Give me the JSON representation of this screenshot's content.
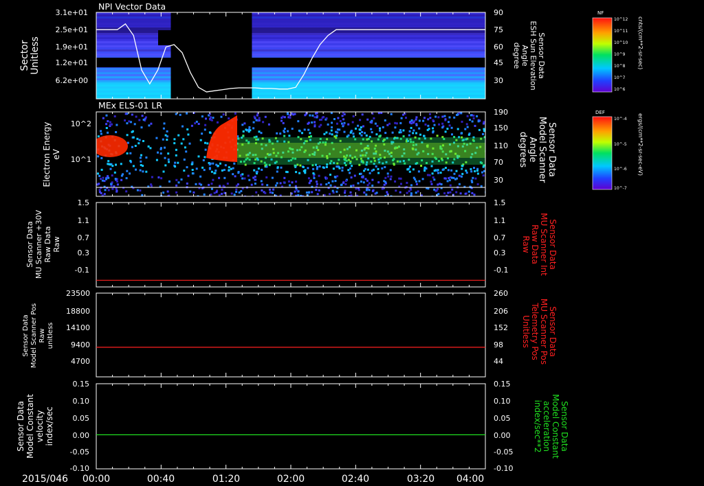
{
  "date_label": "2015/046",
  "time_ticks": [
    "00:00",
    "00:40",
    "01:20",
    "02:00",
    "02:40",
    "03:20",
    "04:00"
  ],
  "colors": {
    "red": "#ff2020",
    "green": "#20e020",
    "white": "#ffffff",
    "black": "#000000"
  },
  "chart_data": [
    {
      "type": "heatmap",
      "title": "NPI Vector Data",
      "ylabel_left": [
        "Sector",
        "Unitless"
      ],
      "left_ticks": [
        "3.1e+01",
        "2.5e+01",
        "1.9e+01",
        "1.2e+01",
        "6.2e+00"
      ],
      "ylabel_right": [
        "Sensor Data",
        "ESH Sun Elevation",
        "Angle",
        "degree"
      ],
      "right_ticks": [
        "90",
        "75",
        "60",
        "45",
        "30"
      ],
      "overlay_line": {
        "name": "ESH Sun Elevation Angle",
        "x_min": [
          0,
          8,
          13,
          18,
          23,
          28,
          33,
          38,
          43,
          48,
          53,
          58,
          63,
          68,
          73,
          78,
          83,
          88,
          93,
          98,
          103,
          108,
          113,
          118,
          123,
          128,
          133,
          138,
          143,
          148,
          153,
          158,
          163,
          168,
          173,
          178,
          183,
          188,
          193,
          198,
          203,
          208,
          213,
          218,
          223,
          228,
          233,
          238,
          240
        ],
        "y_deg": [
          75,
          75,
          75,
          80,
          70,
          40,
          28,
          40,
          60,
          62,
          55,
          38,
          25,
          21,
          22,
          23,
          24,
          24.5,
          24.5,
          24.5,
          24,
          24,
          23.5,
          23.5,
          25,
          36,
          50,
          62,
          70,
          75,
          75,
          75,
          75,
          75,
          75,
          75,
          75,
          75,
          75,
          75,
          75,
          75,
          75,
          75,
          75,
          75,
          75,
          75,
          75
        ]
      },
      "data_gap_min": [
        46,
        96
      ],
      "colorbar": {
        "label": "NF",
        "unit": "cnts/(cm**2-sr-sec)",
        "ticks": [
          "10^12",
          "10^11",
          "10^10",
          "10^9",
          "10^8",
          "10^7",
          "10^6"
        ]
      }
    },
    {
      "type": "heatmap",
      "title": "MEx ELS-01 LR",
      "ylabel_left": [
        "Electron Energy",
        "eV"
      ],
      "left_ticks": [
        "10^2",
        "10^1"
      ],
      "ylabel_right": [
        "Sensor Data",
        "Model Scanner",
        "Angle",
        "degrees"
      ],
      "right_ticks": [
        "190",
        "150",
        "110",
        "70",
        "30"
      ],
      "colorbar": {
        "label": "DEF",
        "unit": "ergs/(cm**2-sr-sec-eV)",
        "ticks": [
          "10^-4",
          "10^-5",
          "10^-6",
          "10^-7"
        ]
      }
    },
    {
      "type": "line",
      "ylabel_left": [
        "Sensor Data",
        "MU Scanner +30V",
        "Raw Data",
        "Raw"
      ],
      "ylabel_right": [
        "Sensor Data",
        "MU Scanner Int",
        "Raw Data",
        "Raw"
      ],
      "y_ticks": [
        "1.5",
        "1.1",
        "0.7",
        "0.3",
        "-0.1"
      ],
      "ylim": [
        -0.4,
        1.5
      ],
      "series": [
        {
          "name": "MU Scanner Int Raw Data",
          "x_min": [
            0,
            240
          ],
          "y": [
            -0.25,
            -0.25
          ]
        }
      ]
    },
    {
      "type": "line",
      "ylabel_left": [
        "Sensor Data",
        "Model Scanner Pos",
        "Raw",
        "unitless"
      ],
      "ylabel_right": [
        "Sensor Data",
        "MU Scanner Pos",
        "Telemetry Pos",
        "Unitless"
      ],
      "left_ticks": [
        "23500",
        "18800",
        "14100",
        "9400",
        "4700"
      ],
      "right_ticks": [
        "260",
        "206",
        "152",
        "98",
        "44"
      ],
      "ylim": [
        0,
        23500
      ],
      "series": [
        {
          "name": "MU Scanner Pos Telemetry Pos",
          "x_min": [
            0,
            240
          ],
          "y": [
            8300,
            8300
          ]
        }
      ]
    },
    {
      "type": "line",
      "ylabel_left": [
        "Sensor Data",
        "Model Constant",
        "velocity",
        "index/sec"
      ],
      "ylabel_right": [
        "Sensor Data",
        "Model Constant",
        "acceleration",
        "index/sec**2"
      ],
      "y_ticks": [
        "0.15",
        "0.10",
        "0.05",
        "0.00",
        "-0.05",
        "-0.10"
      ],
      "ylim": [
        -0.1,
        0.15
      ],
      "series": [
        {
          "name": "Model Constant acceleration",
          "x_min": [
            0,
            240
          ],
          "y": [
            0,
            0
          ]
        }
      ]
    }
  ]
}
